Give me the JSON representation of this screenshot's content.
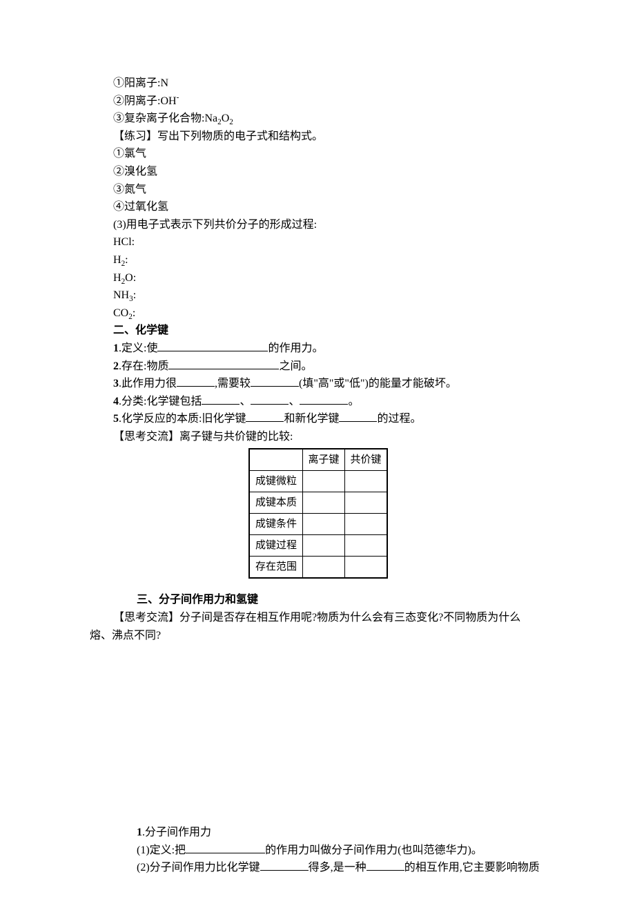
{
  "ex_cation": "①阳离子:N",
  "ex_anion_pre": "②阴离子:OH",
  "ex_anion_sup": "-",
  "ex_complex_ionic_pre": "③复杂离子化合物:Na",
  "ex_sub2": "2",
  "ex_O": "O",
  "practice_title": "【练习】写出下列物质的电子式和结构式。",
  "p1": "①氯气",
  "p2": "②溴化氢",
  "p3": "③氮气",
  "p4": "④过氧化氢",
  "q3_title": "(3)用电子式表示下列共价分子的形成过程:",
  "hcl": "HCl:",
  "h2_pre": "H",
  "colon": ":",
  "h2o_pre": "H",
  "h2o_suf": "O:",
  "nh3_pre": "NH",
  "sub3": "3",
  "co2_pre": "CO",
  "sec2_title": "二、化学键",
  "s2_1a": "1",
  "s2_1b": ".定义:使",
  "s2_1c": "的作用力。",
  "s2_2a": "2",
  "s2_2b": ".存在:物质",
  "s2_2c": "之间。",
  "s2_3a": "3",
  "s2_3b": ".此作用力很",
  "s2_3c": ",需要较",
  "s2_3d": "(填\"高\"或\"低\")的能量才能破坏。",
  "s2_4a": "4",
  "s2_4b": ".分类:化学键包括",
  "sep": "、",
  "s2_4c": "。",
  "s2_5a": "5",
  "s2_5b": ".化学反应的本质:旧化学键",
  "s2_5c": "和新化学键",
  "s2_5d": "的过程。",
  "think1": "【思考交流】离子键与共价键的比较:",
  "tbl": {
    "h_ionic": "离子键",
    "h_cov": "共价键",
    "r1": "成键微粒",
    "r2": "成键本质",
    "r3": "成键条件",
    "r4": "成键过程",
    "r5": "存在范围"
  },
  "sec3_title": "三、分子间作用力和氢键",
  "think2a": "【思考交流】分子间是否存在相互作用呢?物质为什么会有三态变化?不同物质为什么",
  "think2b": "熔、沸点不同?",
  "s3_1a": "1",
  "s3_1b": ".分子间作用力",
  "s3_def_a": "(1)定义:把",
  "s3_def_b": "的作用力叫做分子间作用力(也叫范德华力)。",
  "s3_2a": "(2)分子间作用力比化学键",
  "s3_2b": "得多,是一种",
  "s3_2c": "的相互作用,它主要影响物质"
}
